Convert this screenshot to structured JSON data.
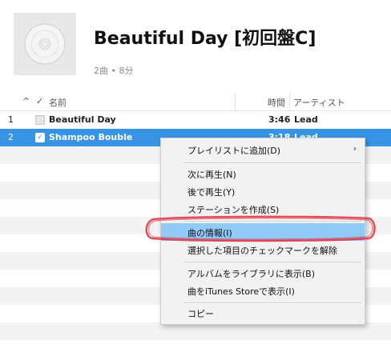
{
  "album": {
    "title": "Beautiful Day [初回盤C]",
    "subtitle": "2曲 • 8分"
  },
  "table_header": {
    "sort_indicator": "^",
    "check": "✓",
    "name": "名前",
    "time": "時間",
    "artist": "アーティスト"
  },
  "tracks": [
    {
      "num": "1",
      "name": "Beautiful Day",
      "time": "3:46",
      "artist": "Lead",
      "checked": false
    },
    {
      "num": "2",
      "name": "Shampoo Bouble",
      "time": "3:18",
      "artist": "Lead",
      "checked": true
    }
  ],
  "context_menu": {
    "items": [
      {
        "label": "プレイリストに追加(D)",
        "submenu": true
      },
      {
        "label": "次に再生(N)"
      },
      {
        "label": "後で再生(Y)"
      },
      {
        "label": "ステーションを作成(S)"
      },
      {
        "label": "曲の情報(I)",
        "highlighted": true
      },
      {
        "label": "選択した項目のチェックマークを解除"
      },
      {
        "label": "アルバムをライブラリに表示(B)"
      },
      {
        "label": "曲をiTunes Storeで表示(I)"
      },
      {
        "label": "コピー"
      }
    ],
    "submenu_arrow": "›"
  },
  "colors": {
    "selection": "#3793e4",
    "menu_highlight": "#91c9f7",
    "annotation_oval": "#e03040"
  }
}
